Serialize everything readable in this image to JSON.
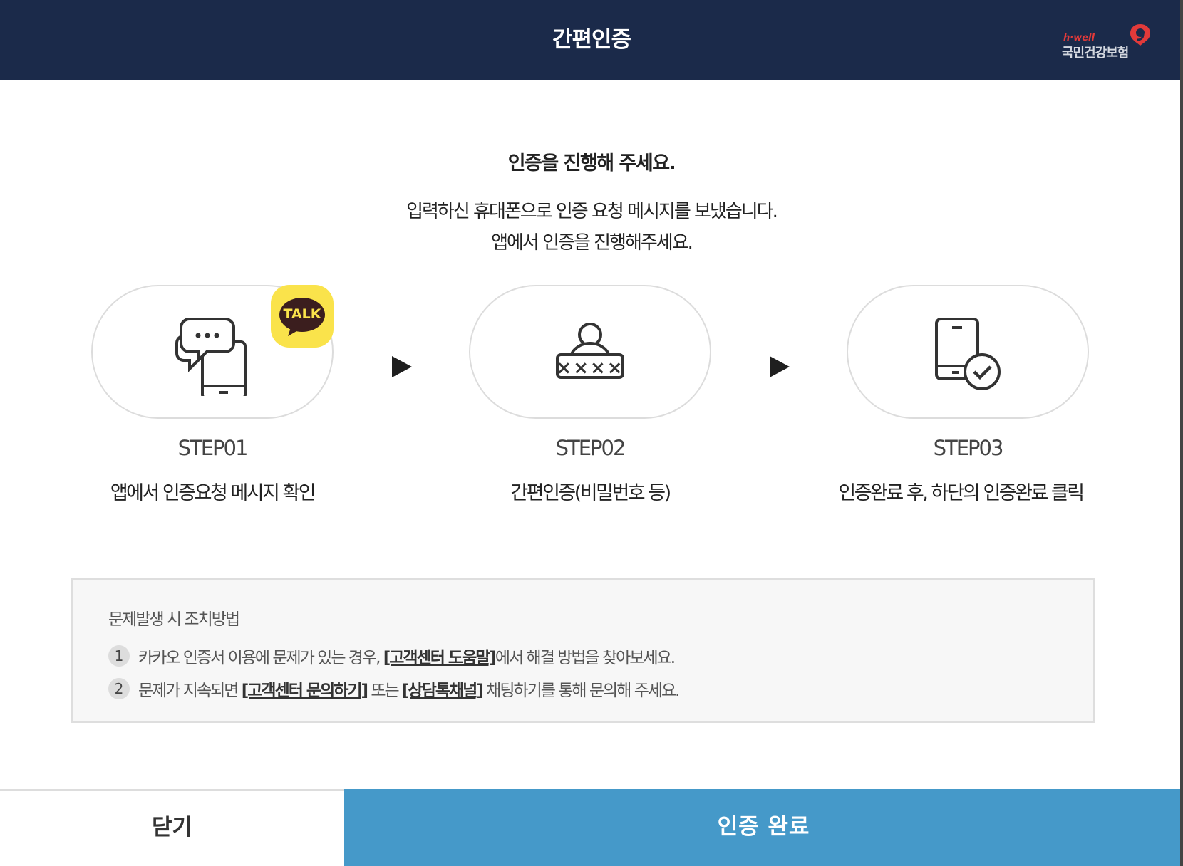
{
  "header": {
    "title": "간편인증",
    "logo": {
      "small": "h·well",
      "main": "국민건강보험"
    }
  },
  "main": {
    "heading": "인증을 진행해 주세요.",
    "desc_line1": "입력하신 휴대폰으로 인증 요청 메시지를 보냈습니다.",
    "desc_line2": "앱에서 인증을 진행해주세요."
  },
  "steps": [
    {
      "label": "STEP01",
      "desc": "앱에서 인증요청 메시지 확인",
      "icon": "chat-phone-icon"
    },
    {
      "label": "STEP02",
      "desc": "간편인증(비밀번호 등)",
      "icon": "password-user-icon"
    },
    {
      "label": "STEP03",
      "desc": "인증완료 후, 하단의 인증완료 클릭",
      "icon": "phone-check-icon"
    }
  ],
  "talk_badge": {
    "text": "TALK",
    "color": "#fae34b"
  },
  "password_mask": "××××",
  "help": {
    "title": "문제발생 시 조치방법",
    "rows": [
      {
        "number": "1",
        "text1": "카카오 인증서 이용에 문제가 있는 경우, ",
        "link1": "[고객센터 도움말]",
        "text2": "에서 해결 방법을 찾아보세요."
      },
      {
        "number": "2",
        "text1": "문제가 지속되면 ",
        "link1": "[고객센터 문의하기]",
        "text2": " 또는 ",
        "link2": "[상담톡채널]",
        "text3": " 채팅하기를 통해 문의해 주세요."
      }
    ]
  },
  "footer": {
    "close_label": "닫기",
    "confirm_label": "인증 완료"
  },
  "colors": {
    "header_bg": "#1b2a4a",
    "confirm_bg": "#4599c9",
    "logo_accent": "#e23a3a"
  }
}
